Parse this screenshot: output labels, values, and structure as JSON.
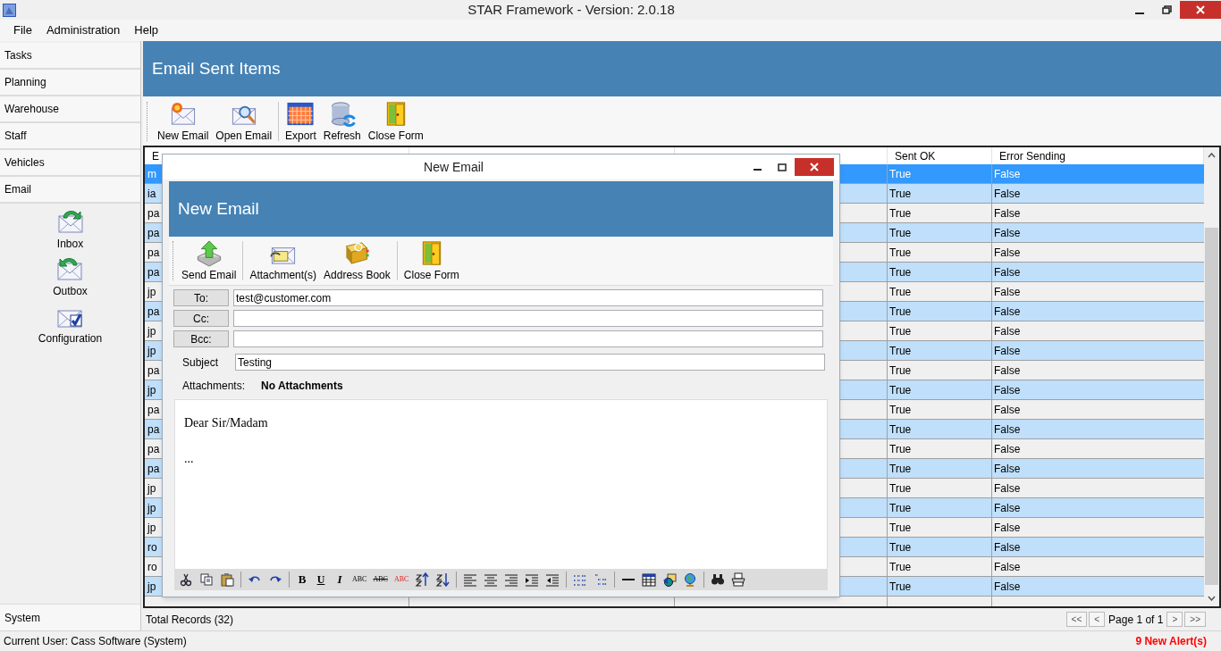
{
  "window": {
    "title": "STAR Framework - Version: 2.0.18"
  },
  "menu": [
    {
      "label": "File"
    },
    {
      "label": "Administration"
    },
    {
      "label": "Help"
    }
  ],
  "sidebar": {
    "items": [
      {
        "label": "Tasks"
      },
      {
        "label": "Planning"
      },
      {
        "label": "Warehouse"
      },
      {
        "label": "Staff"
      },
      {
        "label": "Vehicles"
      },
      {
        "label": "Email"
      }
    ],
    "email_items": [
      {
        "label": "Inbox",
        "kind": "inbox"
      },
      {
        "label": "Outbox",
        "kind": "outbox"
      },
      {
        "label": "Configuration",
        "kind": "config"
      }
    ],
    "footer": "System"
  },
  "main": {
    "title": "Email Sent Items",
    "toolbar": [
      {
        "label": "New Email",
        "kind": "new"
      },
      {
        "label": "Open Email",
        "kind": "open"
      },
      {
        "kind": "sep"
      },
      {
        "label": "Export",
        "kind": "export"
      },
      {
        "label": "Refresh",
        "kind": "refresh"
      },
      {
        "label": "Close Form",
        "kind": "door"
      }
    ],
    "table": {
      "columns": [
        "E",
        "",
        "",
        "Sent OK",
        "Error Sending"
      ],
      "rows": [
        {
          "cells": [
            "m",
            "True",
            "False"
          ],
          "selected": true
        },
        {
          "cells": [
            "ia",
            "True",
            "False"
          ],
          "selected": false
        },
        {
          "cells": [
            "pa",
            "True",
            "False"
          ],
          "selected": false
        },
        {
          "cells": [
            "pa",
            "True",
            "False"
          ],
          "selected": false
        },
        {
          "cells": [
            "pa",
            "True",
            "False"
          ],
          "selected": false
        },
        {
          "cells": [
            "pa",
            "True",
            "False"
          ],
          "selected": false
        },
        {
          "cells": [
            "jp",
            "True",
            "False"
          ],
          "selected": false
        },
        {
          "cells": [
            "pa",
            "True",
            "False"
          ],
          "selected": false
        },
        {
          "cells": [
            "jp",
            "True",
            "False"
          ],
          "selected": false
        },
        {
          "cells": [
            "jp",
            "True",
            "False"
          ],
          "selected": false
        },
        {
          "cells": [
            "pa",
            "True",
            "False"
          ],
          "selected": false
        },
        {
          "cells": [
            "jp",
            "True",
            "False"
          ],
          "selected": false
        },
        {
          "cells": [
            "pa",
            "True",
            "False"
          ],
          "selected": false
        },
        {
          "cells": [
            "pa",
            "True",
            "False"
          ],
          "selected": false
        },
        {
          "cells": [
            "pa",
            "True",
            "False"
          ],
          "selected": false
        },
        {
          "cells": [
            "pa",
            "True",
            "False"
          ],
          "selected": false
        },
        {
          "cells": [
            "jp",
            "True",
            "False"
          ],
          "selected": false
        },
        {
          "cells": [
            "jp",
            "True",
            "False"
          ],
          "selected": false
        },
        {
          "cells": [
            "jp",
            "True",
            "False"
          ],
          "selected": false
        },
        {
          "cells": [
            "ro",
            "True",
            "False"
          ],
          "selected": false
        },
        {
          "cells": [
            "ro",
            "True",
            "False"
          ],
          "selected": false
        },
        {
          "cells": [
            "jp",
            "True",
            "False"
          ],
          "selected": false
        }
      ]
    },
    "total_records": "Total Records (32)",
    "pager": {
      "first": "<<",
      "prev": "<",
      "page": "Page 1 of 1",
      "next": ">",
      "last": ">>"
    }
  },
  "status_bar": {
    "user": "Current User: Cass Software (System)",
    "alerts": "9 New Alert(s)"
  },
  "dialog": {
    "title": "New Email",
    "header": "New Email",
    "toolbar": [
      {
        "label": "Send Email",
        "kind": "send"
      },
      {
        "kind": "sep"
      },
      {
        "label": "Attachment(s)",
        "kind": "attach"
      },
      {
        "label": "Address Book",
        "kind": "book"
      },
      {
        "kind": "sep"
      },
      {
        "label": "Close Form",
        "kind": "door"
      }
    ],
    "recipients": [
      {
        "label": "To:",
        "value": "test@customer.com"
      },
      {
        "label": "Cc:"
      },
      {
        "label": "Bcc:"
      }
    ],
    "subject": {
      "label": "Subject",
      "value": "Testing"
    },
    "attachments": {
      "label": "Attachments:",
      "value": "No Attachments"
    },
    "body": [
      "Dear Sir/Madam",
      "..."
    ],
    "format_toolbar": [
      {
        "kind": "cut"
      },
      {
        "kind": "copy"
      },
      {
        "kind": "paste"
      },
      {
        "kind": "sep"
      },
      {
        "kind": "undo"
      },
      {
        "kind": "redo"
      },
      {
        "kind": "sep"
      },
      {
        "kind": "bold",
        "glyph": "B"
      },
      {
        "kind": "underline",
        "glyph": "U"
      },
      {
        "kind": "italic",
        "glyph": "I"
      },
      {
        "kind": "spell",
        "glyph": "ABC"
      },
      {
        "kind": "strike",
        "glyph": "ABC"
      },
      {
        "kind": "color",
        "glyph": "ABC"
      },
      {
        "kind": "sortup"
      },
      {
        "kind": "sortdown"
      },
      {
        "kind": "sep"
      },
      {
        "kind": "left"
      },
      {
        "kind": "center"
      },
      {
        "kind": "right"
      },
      {
        "kind": "indent"
      },
      {
        "kind": "outdent"
      },
      {
        "kind": "sep"
      },
      {
        "kind": "bullets"
      },
      {
        "kind": "numbers"
      },
      {
        "kind": "sep"
      },
      {
        "kind": "hr"
      },
      {
        "kind": "table"
      },
      {
        "kind": "shapes"
      },
      {
        "kind": "globe"
      },
      {
        "kind": "sep"
      },
      {
        "kind": "find"
      },
      {
        "kind": "print"
      }
    ]
  }
}
